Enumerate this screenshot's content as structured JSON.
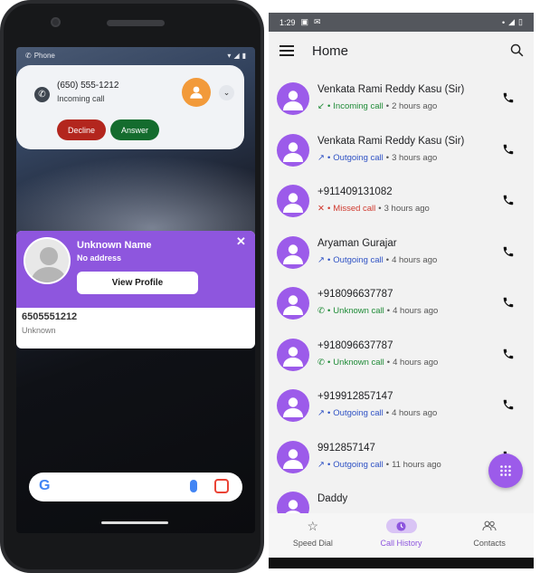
{
  "left_phone": {
    "status": {
      "app": "Phone"
    },
    "notification": {
      "number": "(650) 555-1212",
      "subtitle": "Incoming call",
      "decline_label": "Decline",
      "answer_label": "Answer"
    },
    "caller_card": {
      "name": "Unknown Name",
      "address": "No address",
      "view_profile_label": "View Profile",
      "number": "6505551212",
      "number_label": "Unknown"
    },
    "search": {
      "google_letter": "G"
    }
  },
  "right_app": {
    "status": {
      "time": "1:29"
    },
    "title": "Home",
    "calls": [
      {
        "name": "Venkata Rami Reddy Kasu (Sir)",
        "type": "Incoming call",
        "time": "2 hours ago",
        "kind": "in"
      },
      {
        "name": "Venkata Rami Reddy Kasu (Sir)",
        "type": "Outgoing call",
        "time": "3 hours ago",
        "kind": "out"
      },
      {
        "name": "+911409131082",
        "type": "Missed call",
        "time": "3 hours ago",
        "kind": "miss"
      },
      {
        "name": "Aryaman Gurajar",
        "type": "Outgoing call",
        "time": "4 hours ago",
        "kind": "out"
      },
      {
        "name": "+918096637787",
        "type": "Unknown call",
        "time": "4 hours ago",
        "kind": "unk"
      },
      {
        "name": "+918096637787",
        "type": "Unknown call",
        "time": "4 hours ago",
        "kind": "unk"
      },
      {
        "name": "+919912857147",
        "type": "Outgoing call",
        "time": "4 hours ago",
        "kind": "out"
      },
      {
        "name": "9912857147",
        "type": "Outgoing call",
        "time": "11 hours ago",
        "kind": "out"
      },
      {
        "name": "Daddy",
        "type": "",
        "time": "",
        "kind": "out"
      }
    ],
    "nav": {
      "speed_dial": "Speed Dial",
      "call_history": "Call History",
      "contacts": "Contacts"
    },
    "colors": {
      "accent": "#9c5bea",
      "incoming": "#1f8b37",
      "outgoing": "#2f52c4",
      "missed": "#d03a2f"
    }
  }
}
